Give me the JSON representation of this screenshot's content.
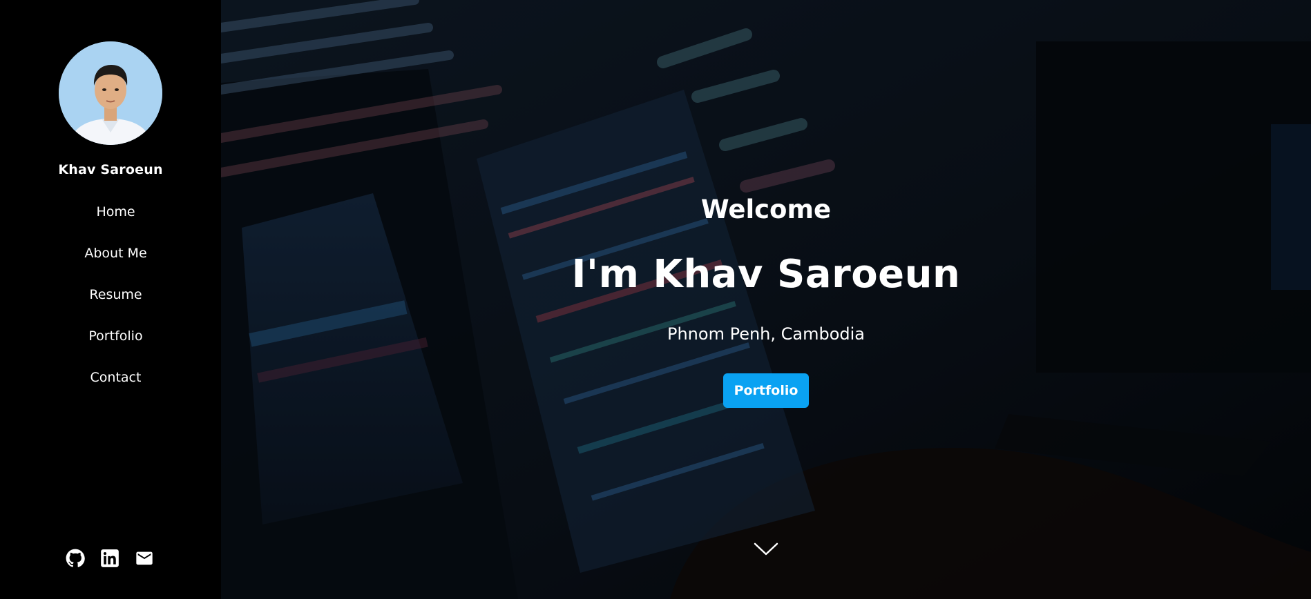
{
  "sidebar": {
    "profile_name": "Khav Saroeun",
    "nav": [
      {
        "label": "Home"
      },
      {
        "label": "About Me"
      },
      {
        "label": "Resume"
      },
      {
        "label": "Portfolio"
      },
      {
        "label": "Contact"
      }
    ],
    "socials": [
      {
        "icon": "github-icon"
      },
      {
        "icon": "linkedin-icon"
      },
      {
        "icon": "mail-icon"
      }
    ]
  },
  "hero": {
    "welcome": "Welcome",
    "headline": "I'm Khav Saroeun",
    "location": "Phnom Penh, Cambodia",
    "cta_label": "Portfolio",
    "scroll_icon": "chevron-down-icon"
  },
  "colors": {
    "sidebar_bg": "#000000",
    "accent": "#0aa2f2",
    "text": "#ffffff"
  }
}
